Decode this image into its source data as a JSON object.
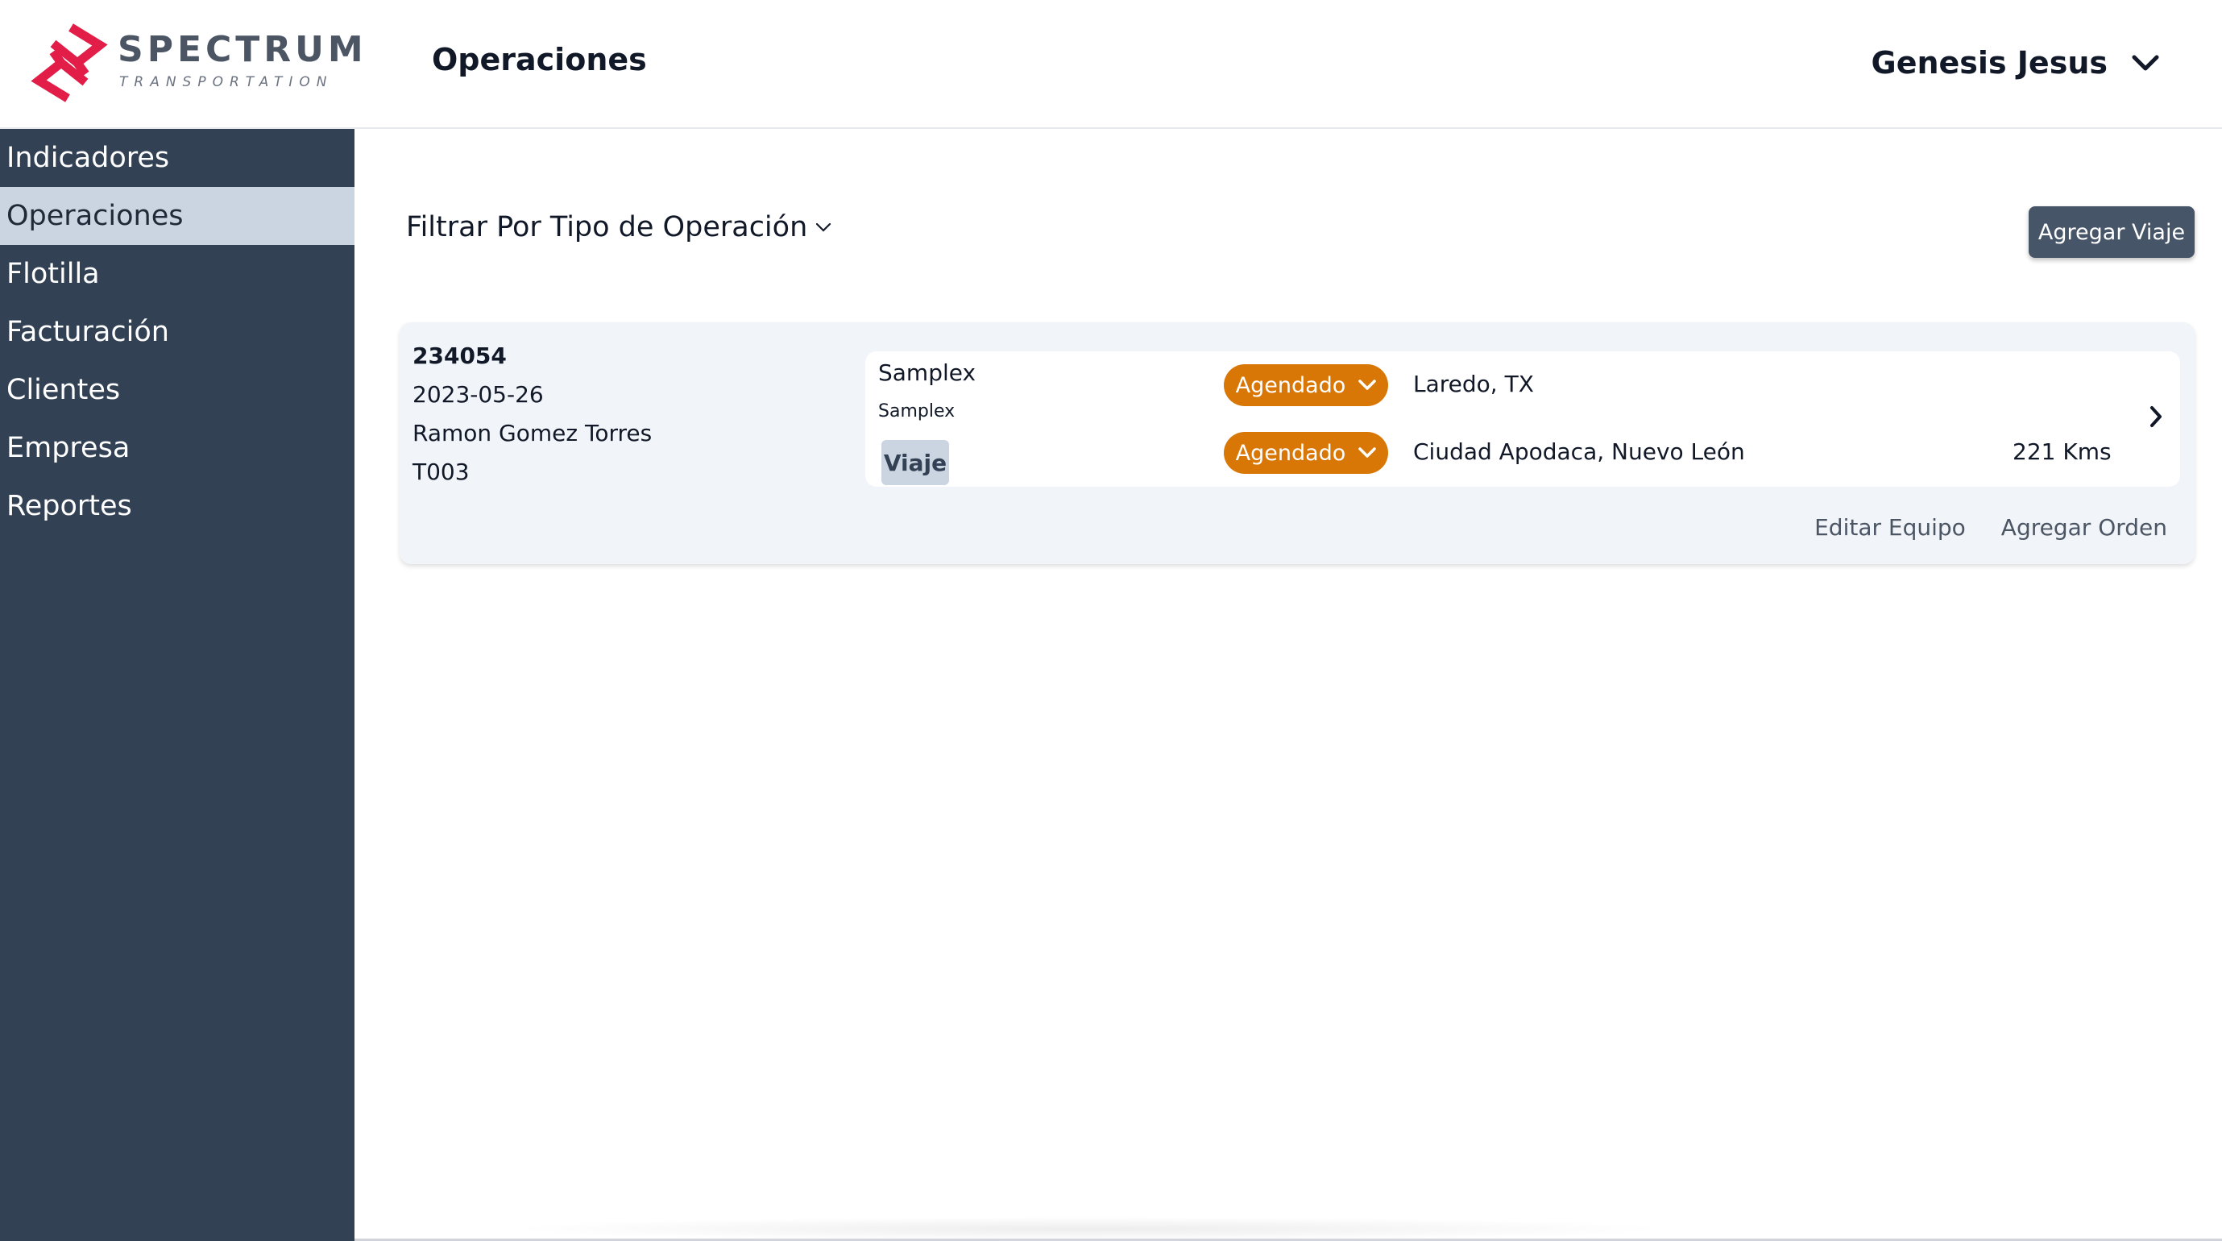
{
  "brand": {
    "name": "SPECTRUM",
    "tagline": "TRANSPORTATION",
    "color": "#e11d48"
  },
  "header": {
    "title": "Operaciones",
    "user_name": "Genesis Jesus"
  },
  "sidebar": {
    "items": [
      {
        "label": "Indicadores"
      },
      {
        "label": "Operaciones",
        "active": true
      },
      {
        "label": "Flotilla"
      },
      {
        "label": "Facturación"
      },
      {
        "label": "Clientes"
      },
      {
        "label": "Empresa"
      },
      {
        "label": "Reportes"
      }
    ]
  },
  "toolbar": {
    "filter_label": "Filtrar Por Tipo de Operación",
    "add_trip_label": "Agregar Viaje"
  },
  "trip": {
    "id": "234054",
    "date": "2023-05-26",
    "driver": "Ramon Gomez Torres",
    "truck": "T003",
    "client": "Samplex",
    "client_secondary": "Samplex",
    "type": "Viaje",
    "origin_status": "Agendado",
    "origin": "Laredo, TX",
    "destination_status": "Agendado",
    "destination": "Ciudad Apodaca, Nuevo León",
    "distance": "221 Kms",
    "edit_equipment_label": "Editar Equipo",
    "add_order_label": "Agregar Orden"
  },
  "colors": {
    "sidebar_bg": "#334155",
    "sidebar_active_bg": "#cbd5e1",
    "status_bg": "#d97706",
    "button_bg": "#475569",
    "card_bg": "#f1f5f9"
  }
}
